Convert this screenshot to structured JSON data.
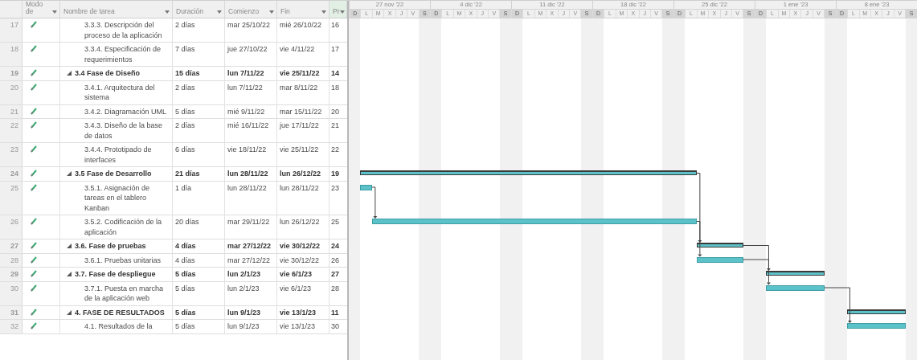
{
  "table": {
    "columns": [
      {
        "label": "Modo de"
      },
      {
        "label": "Nombre de tarea"
      },
      {
        "label": "Duración"
      },
      {
        "label": "Comienzo"
      },
      {
        "label": "Fin"
      },
      {
        "label": "Pr"
      }
    ],
    "rows": [
      {
        "id": "17",
        "kind": "task",
        "name": "3.3.3. Descripción del proceso de la aplicación",
        "duration": "2 días",
        "start": "mar 25/10/22",
        "finish": "mié 26/10/22",
        "predecessors": "16"
      },
      {
        "id": "18",
        "kind": "task",
        "name": "3.3.4. Especificación de requerimientos",
        "duration": "7 días",
        "start": "jue 27/10/22",
        "finish": "vie 4/11/22",
        "predecessors": "17"
      },
      {
        "id": "19",
        "kind": "summary",
        "expanded": true,
        "name": "3.4 Fase de Diseño",
        "duration": "15 días",
        "start": "lun 7/11/22",
        "finish": "vie 25/11/22",
        "predecessors": "14",
        "children": [
          {
            "id": "20",
            "kind": "task",
            "name": "3.4.1. Arquitectura del sistema",
            "duration": "2 días",
            "start": "lun 7/11/22",
            "finish": "mar 8/11/22",
            "predecessors": "18"
          },
          {
            "id": "21",
            "kind": "task",
            "name": "3.4.2. Diagramación UML",
            "duration": "5 días",
            "start": "mié 9/11/22",
            "finish": "mar 15/11/22",
            "predecessors": "20"
          },
          {
            "id": "22",
            "kind": "task",
            "name": "3.4.3. Diseño de la base de datos",
            "duration": "2 días",
            "start": "mié 16/11/22",
            "finish": "jue 17/11/22",
            "predecessors": "21"
          },
          {
            "id": "23",
            "kind": "task",
            "name": "3.4.4. Prototipado de interfaces",
            "duration": "6 días",
            "start": "vie 18/11/22",
            "finish": "vie 25/11/22",
            "predecessors": "22"
          }
        ]
      },
      {
        "id": "24",
        "kind": "summary",
        "expanded": true,
        "name": "3.5 Fase de Desarrollo",
        "duration": "21 días",
        "start": "lun 28/11/22",
        "finish": "lun 26/12/22",
        "predecessors": "19",
        "children": [
          {
            "id": "25",
            "kind": "task",
            "name": "3.5.1. Asignación de tareas en el tablero Kanban",
            "duration": "1 día",
            "start": "lun 28/11/22",
            "finish": "lun 28/11/22",
            "predecessors": "23"
          },
          {
            "id": "26",
            "kind": "task",
            "name": "3.5.2. Codificación de la aplicación",
            "duration": "20 días",
            "start": "mar 29/11/22",
            "finish": "lun 26/12/22",
            "predecessors": "25"
          }
        ]
      },
      {
        "id": "27",
        "kind": "summary",
        "expanded": true,
        "name": "3.6. Fase de pruebas",
        "duration": "4 días",
        "start": "mar 27/12/22",
        "finish": "vie 30/12/22",
        "predecessors": "24",
        "children": [
          {
            "id": "28",
            "kind": "task",
            "name": "3.6.1. Pruebas unitarias",
            "duration": "4 días",
            "start": "mar 27/12/22",
            "finish": "vie 30/12/22",
            "predecessors": "26"
          }
        ]
      },
      {
        "id": "29",
        "kind": "summary",
        "expanded": true,
        "name": "3.7. Fase de despliegue",
        "duration": "5 días",
        "start": "lun 2/1/23",
        "finish": "vie 6/1/23",
        "predecessors": "27",
        "children": [
          {
            "id": "30",
            "kind": "task",
            "name": "3.7.1. Puesta en marcha de la aplicación web",
            "duration": "5 días",
            "start": "lun 2/1/23",
            "finish": "vie 6/1/23",
            "predecessors": "28"
          }
        ]
      },
      {
        "id": "31",
        "kind": "summary",
        "expanded": true,
        "name": "4. FASE DE RESULTADOS",
        "duration": "5 días",
        "start": "lun 9/1/23",
        "finish": "vie 13/1/23",
        "predecessors": "11",
        "children": [
          {
            "id": "32",
            "kind": "task",
            "name": "4.1. Resultados de la",
            "duration": "5 días",
            "start": "lun 9/1/23",
            "finish": "vie 13/1/23",
            "predecessors": "30"
          }
        ]
      }
    ]
  },
  "timescale": {
    "weeks": [
      {
        "label": "27 nov '22",
        "days": [
          {
            "letter": "D",
            "off": true
          },
          {
            "letter": "L",
            "off": false
          },
          {
            "letter": "M",
            "off": false
          },
          {
            "letter": "X",
            "off": false
          },
          {
            "letter": "J",
            "off": false
          },
          {
            "letter": "V",
            "off": false
          },
          {
            "letter": "S",
            "off": true
          }
        ]
      },
      {
        "label": "4 dic '22",
        "days": [
          {
            "letter": "D",
            "off": true
          },
          {
            "letter": "L",
            "off": false
          },
          {
            "letter": "M",
            "off": false
          },
          {
            "letter": "X",
            "off": false
          },
          {
            "letter": "J",
            "off": false
          },
          {
            "letter": "V",
            "off": false
          },
          {
            "letter": "S",
            "off": true
          }
        ]
      },
      {
        "label": "11 dic '22",
        "days": [
          {
            "letter": "D",
            "off": true
          },
          {
            "letter": "L",
            "off": false
          },
          {
            "letter": "M",
            "off": false
          },
          {
            "letter": "X",
            "off": false
          },
          {
            "letter": "J",
            "off": false
          },
          {
            "letter": "V",
            "off": false
          },
          {
            "letter": "S",
            "off": true
          }
        ]
      },
      {
        "label": "18 dic '22",
        "days": [
          {
            "letter": "D",
            "off": true
          },
          {
            "letter": "L",
            "off": false
          },
          {
            "letter": "M",
            "off": false
          },
          {
            "letter": "X",
            "off": false
          },
          {
            "letter": "J",
            "off": false
          },
          {
            "letter": "V",
            "off": false
          },
          {
            "letter": "S",
            "off": true
          }
        ]
      },
      {
        "label": "25 dic '22",
        "days": [
          {
            "letter": "D",
            "off": true
          },
          {
            "letter": "L",
            "off": false
          },
          {
            "letter": "M",
            "off": false
          },
          {
            "letter": "X",
            "off": false
          },
          {
            "letter": "J",
            "off": false
          },
          {
            "letter": "V",
            "off": false
          },
          {
            "letter": "S",
            "off": true
          }
        ]
      },
      {
        "label": "1 ene '23",
        "days": [
          {
            "letter": "D",
            "off": true
          },
          {
            "letter": "L",
            "off": false
          },
          {
            "letter": "M",
            "off": false
          },
          {
            "letter": "X",
            "off": false
          },
          {
            "letter": "J",
            "off": false
          },
          {
            "letter": "V",
            "off": false
          },
          {
            "letter": "S",
            "off": true
          }
        ]
      },
      {
        "label": "8 ene '23",
        "days": [
          {
            "letter": "D",
            "off": true
          },
          {
            "letter": "L",
            "off": false
          },
          {
            "letter": "M",
            "off": false
          },
          {
            "letter": "X",
            "off": false
          },
          {
            "letter": "J",
            "off": false
          },
          {
            "letter": "V",
            "off": false
          },
          {
            "letter": "S",
            "off": true
          }
        ]
      }
    ]
  }
}
